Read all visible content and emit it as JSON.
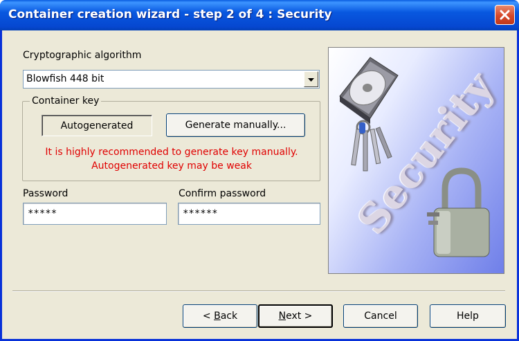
{
  "window": {
    "title": "Container creation wizard - step 2 of 4 : Security",
    "close_icon": "close-icon"
  },
  "algorithm": {
    "label": "Cryptographic algorithm",
    "selected": "Blowfish 448 bit"
  },
  "container_key": {
    "legend": "Container key",
    "autogenerated_label": "Autogenerated",
    "generate_manually_label": "Generate manually...",
    "warning_line1": "It is highly recommended to generate key manually.",
    "warning_line2": "Autogenerated key may be weak"
  },
  "password": {
    "label": "Password",
    "value": "*****"
  },
  "confirm_password": {
    "label": "Confirm password",
    "value": "******"
  },
  "illustration": {
    "word": "Security",
    "icons": [
      "hard-disk-icon",
      "keys-icon",
      "padlock-icon"
    ]
  },
  "buttons": {
    "back_prefix": "< ",
    "back_mnemonic": "B",
    "back_rest": "ack",
    "next_mnemonic": "N",
    "next_rest": "ext >",
    "cancel": "Cancel",
    "help": "Help"
  },
  "colors": {
    "titlebar": "#0858e0",
    "warning": "#e00000",
    "dialog_bg": "#ece9d8"
  }
}
